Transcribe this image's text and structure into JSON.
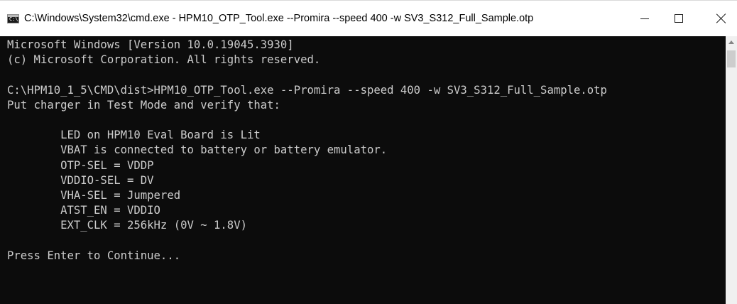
{
  "window": {
    "title": "C:\\Windows\\System32\\cmd.exe - HPM10_OTP_Tool.exe  --Promira --speed 400 -w SV3_S312_Full_Sample.otp",
    "icon": "cmd-icon",
    "icon_glyph": "C:\\",
    "controls": {
      "minimize": "minimize-icon",
      "maximize": "maximize-icon",
      "close": "close-icon"
    }
  },
  "console": {
    "background": "#0c0c0c",
    "foreground": "#cccccc",
    "lines": [
      "Microsoft Windows [Version 10.0.19045.3930]",
      "(c) Microsoft Corporation. All rights reserved.",
      "",
      "C:\\HPM10_1_5\\CMD\\dist>HPM10_OTP_Tool.exe --Promira --speed 400 -w SV3_S312_Full_Sample.otp",
      "Put charger in Test Mode and verify that:",
      "",
      "        LED on HPM10 Eval Board is Lit",
      "        VBAT is connected to battery or battery emulator.",
      "        OTP-SEL = VDDP",
      "        VDDIO-SEL = DV",
      "        VHA-SEL = Jumpered",
      "        ATST_EN = VDDIO",
      "        EXT_CLK = 256kHz (0V ~ 1.8V)",
      "",
      "Press Enter to Continue...",
      "",
      ""
    ]
  },
  "scrollbar": {
    "up_arrow": "scroll-up-arrow-icon"
  }
}
